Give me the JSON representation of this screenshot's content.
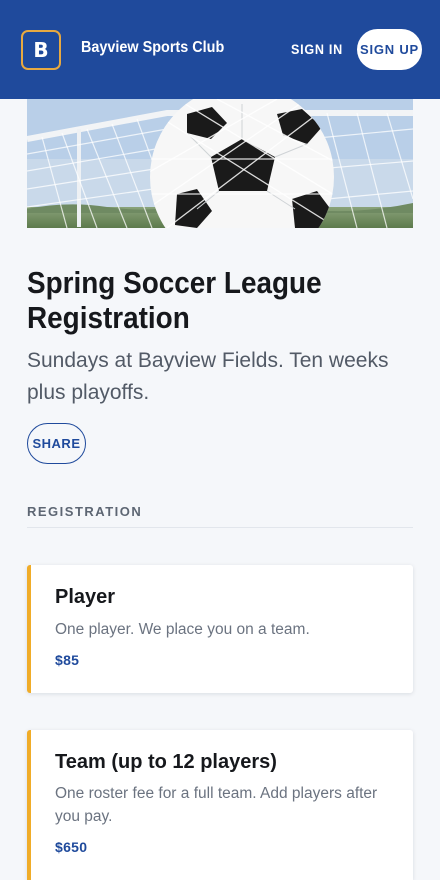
{
  "header": {
    "logo_letter": "B",
    "club_name": "Bayview Sports Club",
    "sign_in": "SIGN IN",
    "sign_up": "SIGN UP"
  },
  "hero": {
    "image": "soccer-ball-in-goal-net"
  },
  "event": {
    "title": "Spring Soccer League Registration",
    "description": "Sundays at Bayview Fields. Ten weeks plus playoffs.",
    "share_label": "SHARE"
  },
  "registration": {
    "section_label": "REGISTRATION",
    "options": [
      {
        "title": "Player",
        "description": "One player. We place you on a team.",
        "price": "$85"
      },
      {
        "title": "Team (up to 12 players)",
        "description": "One roster fee for a full team. Add players after you pay.",
        "price": "$650"
      }
    ]
  },
  "colors": {
    "brand": "#1f4a9c",
    "accent": "#f0ac28",
    "background": "#f5f7fa"
  }
}
